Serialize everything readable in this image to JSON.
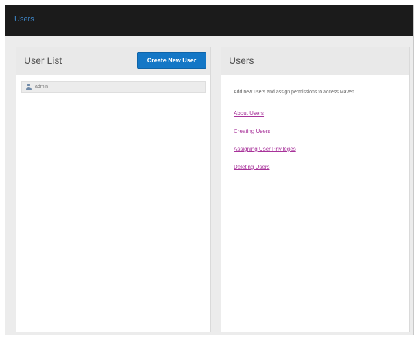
{
  "app": {
    "brand": "Users"
  },
  "user_list_panel": {
    "title": "User List",
    "create_button": "Create New User",
    "users": [
      {
        "name": "admin"
      }
    ]
  },
  "users_panel": {
    "title": "Users",
    "intro": "Add new users and assign permissions to access Maven.",
    "links": [
      {
        "label": "About Users"
      },
      {
        "label": "Creating Users"
      },
      {
        "label": "Assigning User Privileges"
      },
      {
        "label": "Deleting Users"
      }
    ]
  },
  "colors": {
    "topbar": "#1b1b1b",
    "brand_link": "#3d86c8",
    "primary_button": "#1477c6",
    "help_link": "#a8339a"
  },
  "icons": {
    "user_item": "user-icon"
  }
}
